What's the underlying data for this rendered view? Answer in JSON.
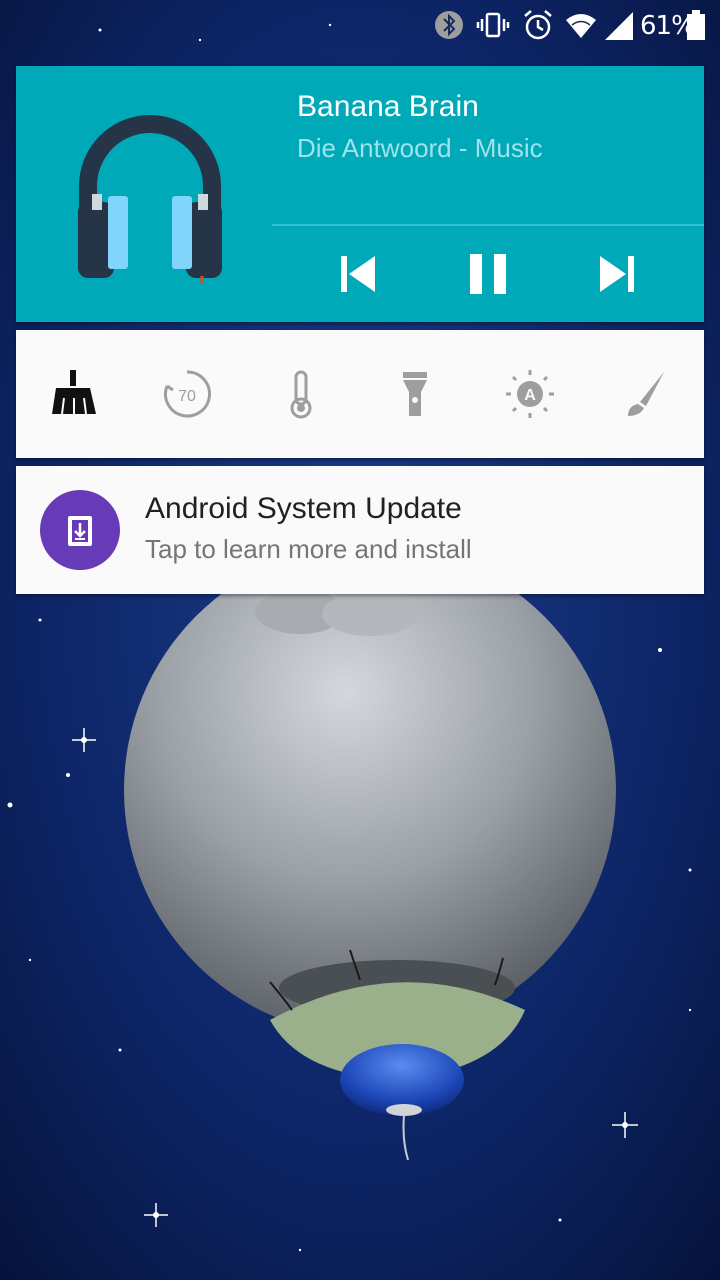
{
  "status_bar": {
    "battery_percent": "61%",
    "icons": [
      "bluetooth-icon",
      "vibrate-icon",
      "alarm-icon",
      "wifi-icon",
      "cell-signal-icon",
      "battery-icon"
    ]
  },
  "media": {
    "title": "Banana Brain",
    "subtitle": "Die Antwoord - Music",
    "app_icon": "headphones-icon",
    "controls": [
      "skip-previous-icon",
      "pause-icon",
      "skip-next-icon"
    ],
    "background_color": "#00a9b8"
  },
  "quick_toggles": {
    "items": [
      {
        "icon": "broom-icon",
        "active": true
      },
      {
        "icon": "timer-icon",
        "label": "70"
      },
      {
        "icon": "thermometer-icon"
      },
      {
        "icon": "flashlight-icon"
      },
      {
        "icon": "auto-brightness-icon",
        "label": "A"
      },
      {
        "icon": "brush-icon"
      }
    ]
  },
  "notification": {
    "title": "Android System Update",
    "text": "Tap to learn more and install",
    "icon": "system-update-icon",
    "icon_color": "#673ab7"
  }
}
